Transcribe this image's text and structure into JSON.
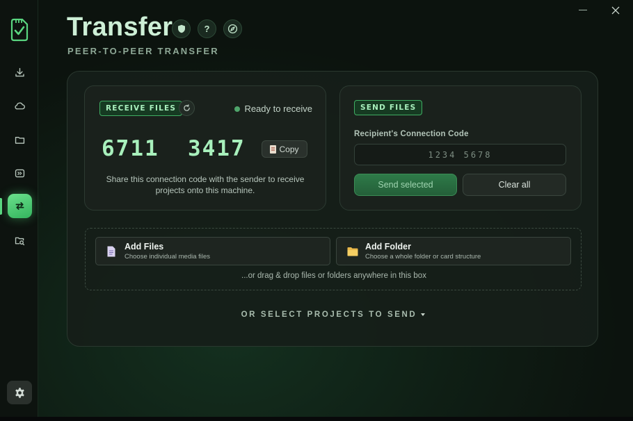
{
  "app": {
    "title": "Transfer",
    "subtitle": "PEER-TO-PEER TRANSFER",
    "accent_color": "#5ad680"
  },
  "header_icons": [
    {
      "name": "shield-icon"
    },
    {
      "name": "help-icon",
      "label": "?"
    },
    {
      "name": "compass-icon"
    }
  ],
  "sidebar": {
    "items": [
      {
        "name": "download-icon"
      },
      {
        "name": "cloud-icon"
      },
      {
        "name": "folder-icon"
      },
      {
        "name": "forward-icon"
      },
      {
        "name": "transfer-icon",
        "active": true
      },
      {
        "name": "folder-search-icon"
      }
    ],
    "settings": "gear-icon"
  },
  "receive": {
    "badge": "RECEIVE FILES",
    "status": "Ready to receive",
    "code": "6711  3417",
    "copy_label": "Copy",
    "hint": "Share this connection code with the sender to receive projects onto this machine."
  },
  "send": {
    "badge": "SEND FILES",
    "field_label": "Recipient's Connection Code",
    "placeholder": "1234 5678",
    "send_label": "Send selected",
    "clear_label": "Clear all"
  },
  "dropzone": {
    "add_files_title": "Add Files",
    "add_files_sub": "Choose individual media files",
    "add_folder_title": "Add Folder",
    "add_folder_sub": "Choose a whole folder or card structure",
    "hint": "...or drag & drop files or folders anywhere in this box"
  },
  "select_projects_label": "OR SELECT PROJECTS TO SEND"
}
